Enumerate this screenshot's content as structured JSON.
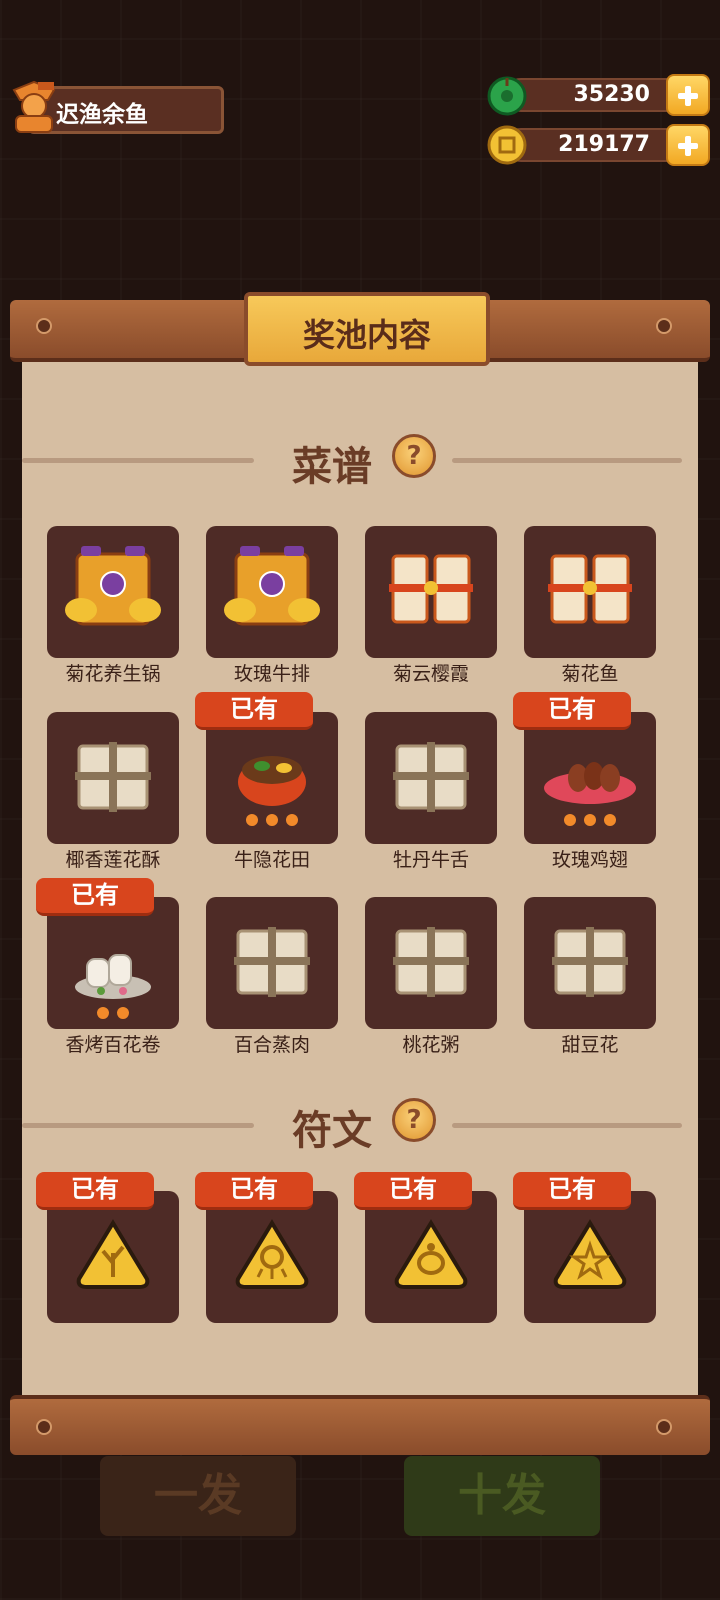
{
  "player": {
    "name": "迟渔余鱼"
  },
  "resources": [
    {
      "id": "jade",
      "value": "35230",
      "icon": "jade-coin-icon",
      "color": "#2ba34a"
    },
    {
      "id": "gold",
      "value": "219177",
      "icon": "gold-coin-icon",
      "color": "#f2c134"
    }
  ],
  "panel": {
    "title": "奖池内容"
  },
  "recipes": {
    "title": "菜谱",
    "help": "?",
    "items": [
      {
        "name": "菊花养生锅",
        "owned": false,
        "icon": "divine-scroll-icon"
      },
      {
        "name": "玫瑰牛排",
        "owned": false,
        "icon": "divine-scroll-icon"
      },
      {
        "name": "菊云樱霞",
        "owned": false,
        "icon": "red-scroll-icon"
      },
      {
        "name": "菊花鱼",
        "owned": false,
        "icon": "red-scroll-icon"
      },
      {
        "name": "椰香莲花酥",
        "owned": false,
        "icon": "plain-scroll-icon"
      },
      {
        "name": "牛隐花田",
        "owned": true,
        "owned_label": "已有",
        "icon": "beef-bowl-dish-icon"
      },
      {
        "name": "牡丹牛舌",
        "owned": false,
        "icon": "plain-scroll-icon"
      },
      {
        "name": "玫瑰鸡翅",
        "owned": true,
        "owned_label": "已有",
        "icon": "chicken-wings-dish-icon"
      },
      {
        "name": "香烤百花卷",
        "owned": true,
        "owned_label": "已有",
        "icon": "flower-roll-dish-icon"
      },
      {
        "name": "百合蒸肉",
        "owned": false,
        "icon": "plain-scroll-icon"
      },
      {
        "name": "桃花粥",
        "owned": false,
        "icon": "plain-scroll-icon"
      },
      {
        "name": "甜豆花",
        "owned": false,
        "icon": "plain-scroll-icon"
      }
    ]
  },
  "runes": {
    "title": "符文",
    "help": "?",
    "items": [
      {
        "owned": true,
        "owned_label": "已有",
        "icon": "coral-rune-icon"
      },
      {
        "owned": true,
        "owned_label": "已有",
        "icon": "octopus-rune-icon"
      },
      {
        "owned": true,
        "owned_label": "已有",
        "icon": "turtle-rune-icon"
      },
      {
        "owned": true,
        "owned_label": "已有",
        "icon": "starfish-rune-icon"
      }
    ]
  },
  "bottom": {
    "single_draw": "一发",
    "ten_draw": "十发"
  }
}
